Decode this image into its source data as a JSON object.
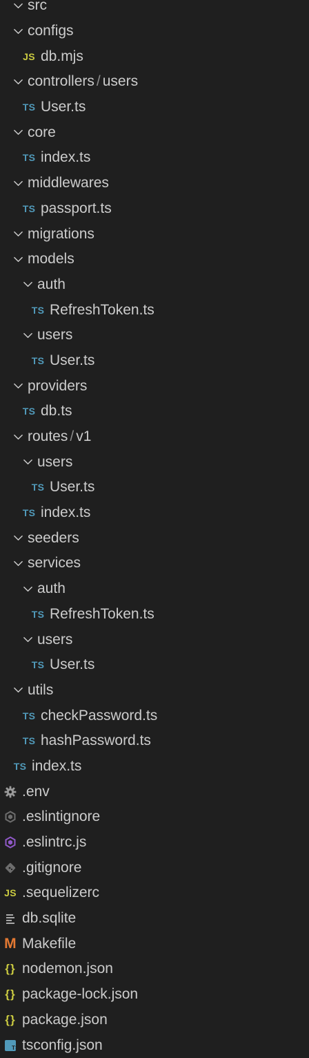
{
  "explorer": {
    "items": [
      {
        "kind": "folder",
        "depth": 0,
        "parts": [
          "src"
        ],
        "icon": "chevron-down-icon"
      },
      {
        "kind": "folder",
        "depth": 1,
        "parts": [
          "configs"
        ],
        "icon": "chevron-down-icon"
      },
      {
        "kind": "file",
        "depth": 1,
        "label": "db.mjs",
        "icon": "javascript-file-icon",
        "icon_text": "JS",
        "icon_class": "js"
      },
      {
        "kind": "folder",
        "depth": 1,
        "parts": [
          "controllers",
          "users"
        ],
        "separator": "/",
        "icon": "chevron-down-icon"
      },
      {
        "kind": "file",
        "depth": 1,
        "label": "User.ts",
        "icon": "typescript-file-icon",
        "icon_text": "TS",
        "icon_class": "ts"
      },
      {
        "kind": "folder",
        "depth": 1,
        "parts": [
          "core"
        ],
        "icon": "chevron-down-icon"
      },
      {
        "kind": "file",
        "depth": 1,
        "label": "index.ts",
        "icon": "typescript-file-icon",
        "icon_text": "TS",
        "icon_class": "ts"
      },
      {
        "kind": "folder",
        "depth": 1,
        "parts": [
          "middlewares"
        ],
        "icon": "chevron-down-icon"
      },
      {
        "kind": "file",
        "depth": 1,
        "label": "passport.ts",
        "icon": "typescript-file-icon",
        "icon_text": "TS",
        "icon_class": "ts"
      },
      {
        "kind": "folder",
        "depth": 1,
        "parts": [
          "migrations"
        ],
        "icon": "chevron-down-icon"
      },
      {
        "kind": "folder",
        "depth": 1,
        "parts": [
          "models"
        ],
        "icon": "chevron-down-icon"
      },
      {
        "kind": "folder",
        "depth": 2,
        "parts": [
          "auth"
        ],
        "icon": "chevron-down-icon"
      },
      {
        "kind": "file",
        "depth": 2,
        "label": "RefreshToken.ts",
        "icon": "typescript-file-icon",
        "icon_text": "TS",
        "icon_class": "ts"
      },
      {
        "kind": "folder",
        "depth": 2,
        "parts": [
          "users"
        ],
        "icon": "chevron-down-icon"
      },
      {
        "kind": "file",
        "depth": 2,
        "label": "User.ts",
        "icon": "typescript-file-icon",
        "icon_text": "TS",
        "icon_class": "ts"
      },
      {
        "kind": "folder",
        "depth": 1,
        "parts": [
          "providers"
        ],
        "icon": "chevron-down-icon"
      },
      {
        "kind": "file",
        "depth": 1,
        "label": "db.ts",
        "icon": "typescript-file-icon",
        "icon_text": "TS",
        "icon_class": "ts"
      },
      {
        "kind": "folder",
        "depth": 1,
        "parts": [
          "routes",
          "v1"
        ],
        "separator": "/",
        "icon": "chevron-down-icon"
      },
      {
        "kind": "folder",
        "depth": 2,
        "parts": [
          "users"
        ],
        "icon": "chevron-down-icon"
      },
      {
        "kind": "file",
        "depth": 2,
        "label": "User.ts",
        "icon": "typescript-file-icon",
        "icon_text": "TS",
        "icon_class": "ts"
      },
      {
        "kind": "file",
        "depth": 1,
        "label": "index.ts",
        "icon": "typescript-file-icon",
        "icon_text": "TS",
        "icon_class": "ts"
      },
      {
        "kind": "folder",
        "depth": 1,
        "parts": [
          "seeders"
        ],
        "icon": "chevron-down-icon"
      },
      {
        "kind": "folder",
        "depth": 1,
        "parts": [
          "services"
        ],
        "icon": "chevron-down-icon"
      },
      {
        "kind": "folder",
        "depth": 2,
        "parts": [
          "auth"
        ],
        "icon": "chevron-down-icon"
      },
      {
        "kind": "file",
        "depth": 2,
        "label": "RefreshToken.ts",
        "icon": "typescript-file-icon",
        "icon_text": "TS",
        "icon_class": "ts"
      },
      {
        "kind": "folder",
        "depth": 2,
        "parts": [
          "users"
        ],
        "icon": "chevron-down-icon"
      },
      {
        "kind": "file",
        "depth": 2,
        "label": "User.ts",
        "icon": "typescript-file-icon",
        "icon_text": "TS",
        "icon_class": "ts"
      },
      {
        "kind": "folder",
        "depth": 1,
        "parts": [
          "utils"
        ],
        "icon": "chevron-down-icon"
      },
      {
        "kind": "file",
        "depth": 1,
        "label": "checkPassword.ts",
        "icon": "typescript-file-icon",
        "icon_text": "TS",
        "icon_class": "ts"
      },
      {
        "kind": "file",
        "depth": 1,
        "label": "hashPassword.ts",
        "icon": "typescript-file-icon",
        "icon_text": "TS",
        "icon_class": "ts"
      },
      {
        "kind": "file",
        "depth": 0.5,
        "label": "index.ts",
        "icon": "typescript-file-icon",
        "icon_text": "TS",
        "icon_class": "ts"
      },
      {
        "kind": "file",
        "depth": 0,
        "label": ".env",
        "icon": "gear-icon"
      },
      {
        "kind": "file",
        "depth": 0,
        "label": ".eslintignore",
        "icon": "eslint-ignore-icon"
      },
      {
        "kind": "file",
        "depth": 0,
        "label": ".eslintrc.js",
        "icon": "eslint-icon"
      },
      {
        "kind": "file",
        "depth": 0,
        "label": ".gitignore",
        "icon": "git-icon"
      },
      {
        "kind": "file",
        "depth": 0,
        "label": ".sequelizerc",
        "icon": "javascript-file-icon",
        "icon_text": "JS",
        "icon_class": "js"
      },
      {
        "kind": "file",
        "depth": 0,
        "label": "db.sqlite",
        "icon": "text-file-icon"
      },
      {
        "kind": "file",
        "depth": 0,
        "label": "Makefile",
        "icon": "makefile-icon",
        "icon_text": "M",
        "icon_class": "m"
      },
      {
        "kind": "file",
        "depth": 0,
        "label": "nodemon.json",
        "icon": "json-file-icon",
        "icon_text": "{}",
        "icon_class": "json"
      },
      {
        "kind": "file",
        "depth": 0,
        "label": "package-lock.json",
        "icon": "json-file-icon",
        "icon_text": "{}",
        "icon_class": "json"
      },
      {
        "kind": "file",
        "depth": 0,
        "label": "package.json",
        "icon": "json-file-icon",
        "icon_text": "{}",
        "icon_class": "json"
      },
      {
        "kind": "file",
        "depth": 0,
        "label": "tsconfig.json",
        "icon": "tsconfig-file-icon"
      }
    ]
  },
  "colors": {
    "background": "#1f1f1f",
    "text": "#cccccc",
    "typescript": "#519aba",
    "javascript": "#cbcb41",
    "json": "#cbcb41",
    "makefile": "#e37933",
    "eslint": "#8f58c7",
    "git": "#6d6d6d",
    "gear": "#9a9a9a"
  }
}
